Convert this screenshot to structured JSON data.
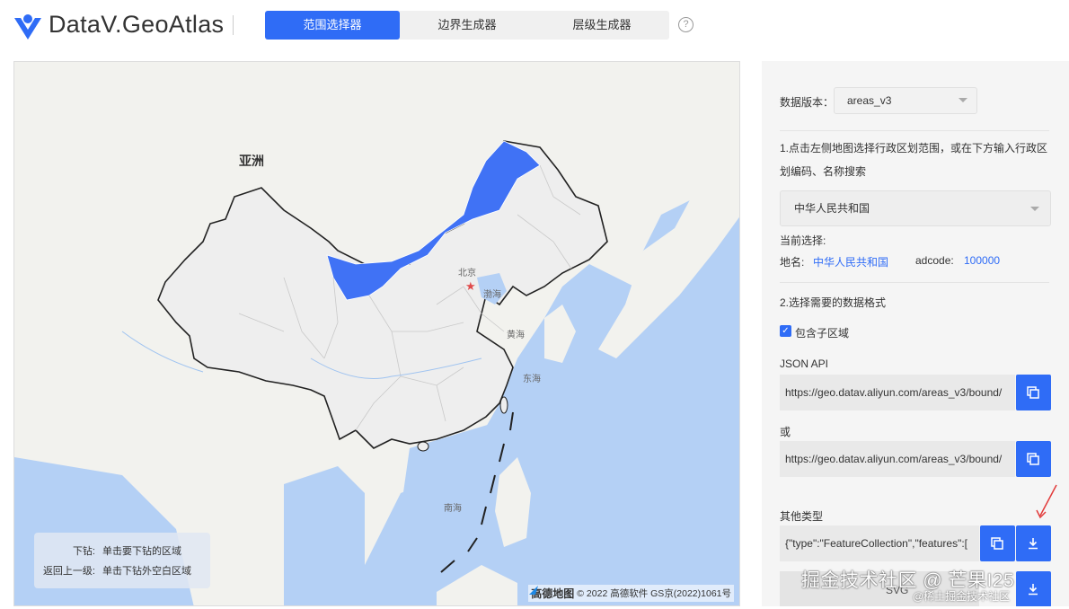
{
  "app": {
    "title": "DataV.GeoAtlas"
  },
  "tabs": [
    {
      "label": "范围选择器",
      "active": true
    },
    {
      "label": "边界生成器",
      "active": false
    },
    {
      "label": "层级生成器",
      "active": false
    }
  ],
  "help": {
    "label": "?"
  },
  "map": {
    "continent_label": "亚洲",
    "place_labels": {
      "beijing": "北京",
      "bohai": "渤海",
      "huanghai": "黄海",
      "donghai": "东海",
      "nanhai": "南海"
    },
    "legend": [
      {
        "key": "下钻:",
        "value": "单击要下钻的区域"
      },
      {
        "key": "返回上一级:",
        "value": "单击下钻外空白区域"
      }
    ],
    "copyright": {
      "brand": "高德地图",
      "text": "© 2022 高德软件 GS京(2022)1061号"
    },
    "colors": {
      "sea": "#b4d0f5",
      "land": "#f3f3f1",
      "selected": "#4072f5",
      "border": "#222222"
    }
  },
  "panel": {
    "version_label": "数据版本：",
    "version_value": "areas_v3",
    "step1": "1.点击左侧地图选择行政区划范围，或在下方输入行政区划编码、名称搜索",
    "region_search_value": "中华人民共和国",
    "current_selection_label": "当前选择:",
    "name_label": "地名:",
    "name_value": "中华人民共和国",
    "adcode_label": "adcode:",
    "adcode_value": "100000",
    "step2": "2.选择需要的数据格式",
    "include_children_label": "包含子区域",
    "include_children_checked": true,
    "json_api_label": "JSON API",
    "json_api_url": "https://geo.datav.aliyun.com/areas_v3/bound/",
    "or_label": "或",
    "json_api_url_2": "https://geo.datav.aliyun.com/areas_v3/bound/",
    "other_types_label": "其他类型",
    "other_types_value": "{\"type\":\"FeatureCollection\",\"features\":[",
    "svg_label": "SVG"
  },
  "watermark": {
    "main": "掘金技术社区 @ 芒果I25",
    "sub": "@稀土掘金技术社区"
  }
}
